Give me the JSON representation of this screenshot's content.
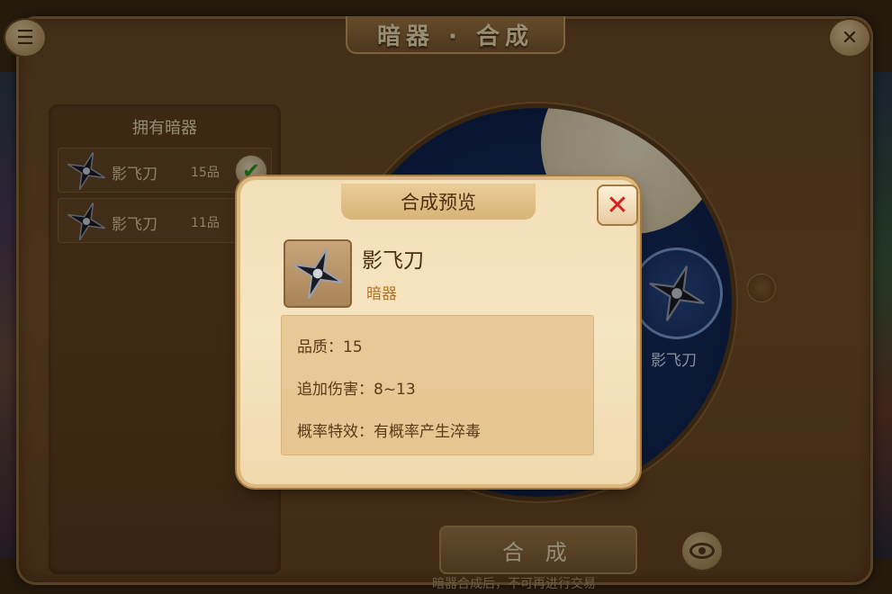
{
  "header": {
    "title": "暗器 · 合成"
  },
  "owned_list": {
    "title": "拥有暗器",
    "items": [
      {
        "name": "影飞刀",
        "grade": "15品",
        "checked": true
      },
      {
        "name": "影飞刀",
        "grade": "11品",
        "checked": true
      }
    ]
  },
  "disc": {
    "slot_label": "影飞刀"
  },
  "synth_button": {
    "label": "合 成"
  },
  "footer_note": "暗器合成后，不可再进行交易",
  "modal": {
    "title": "合成预览",
    "item_name": "影飞刀",
    "item_type": "暗器",
    "stats": [
      {
        "label": "品质：",
        "value": "15"
      },
      {
        "label": "追加伤害：",
        "value": "8~13"
      },
      {
        "label": "概率特效：",
        "value": "有概率产生淬毒"
      }
    ]
  },
  "colors": {
    "close_x": "#d61e1e",
    "check_green": "#2f9a23",
    "panel_brown": "#785229",
    "modal_cream": "#f6e5c2"
  },
  "icons": [
    "shuriken-icon",
    "check-icon",
    "close-icon",
    "eye-icon",
    "menu-icon"
  ]
}
